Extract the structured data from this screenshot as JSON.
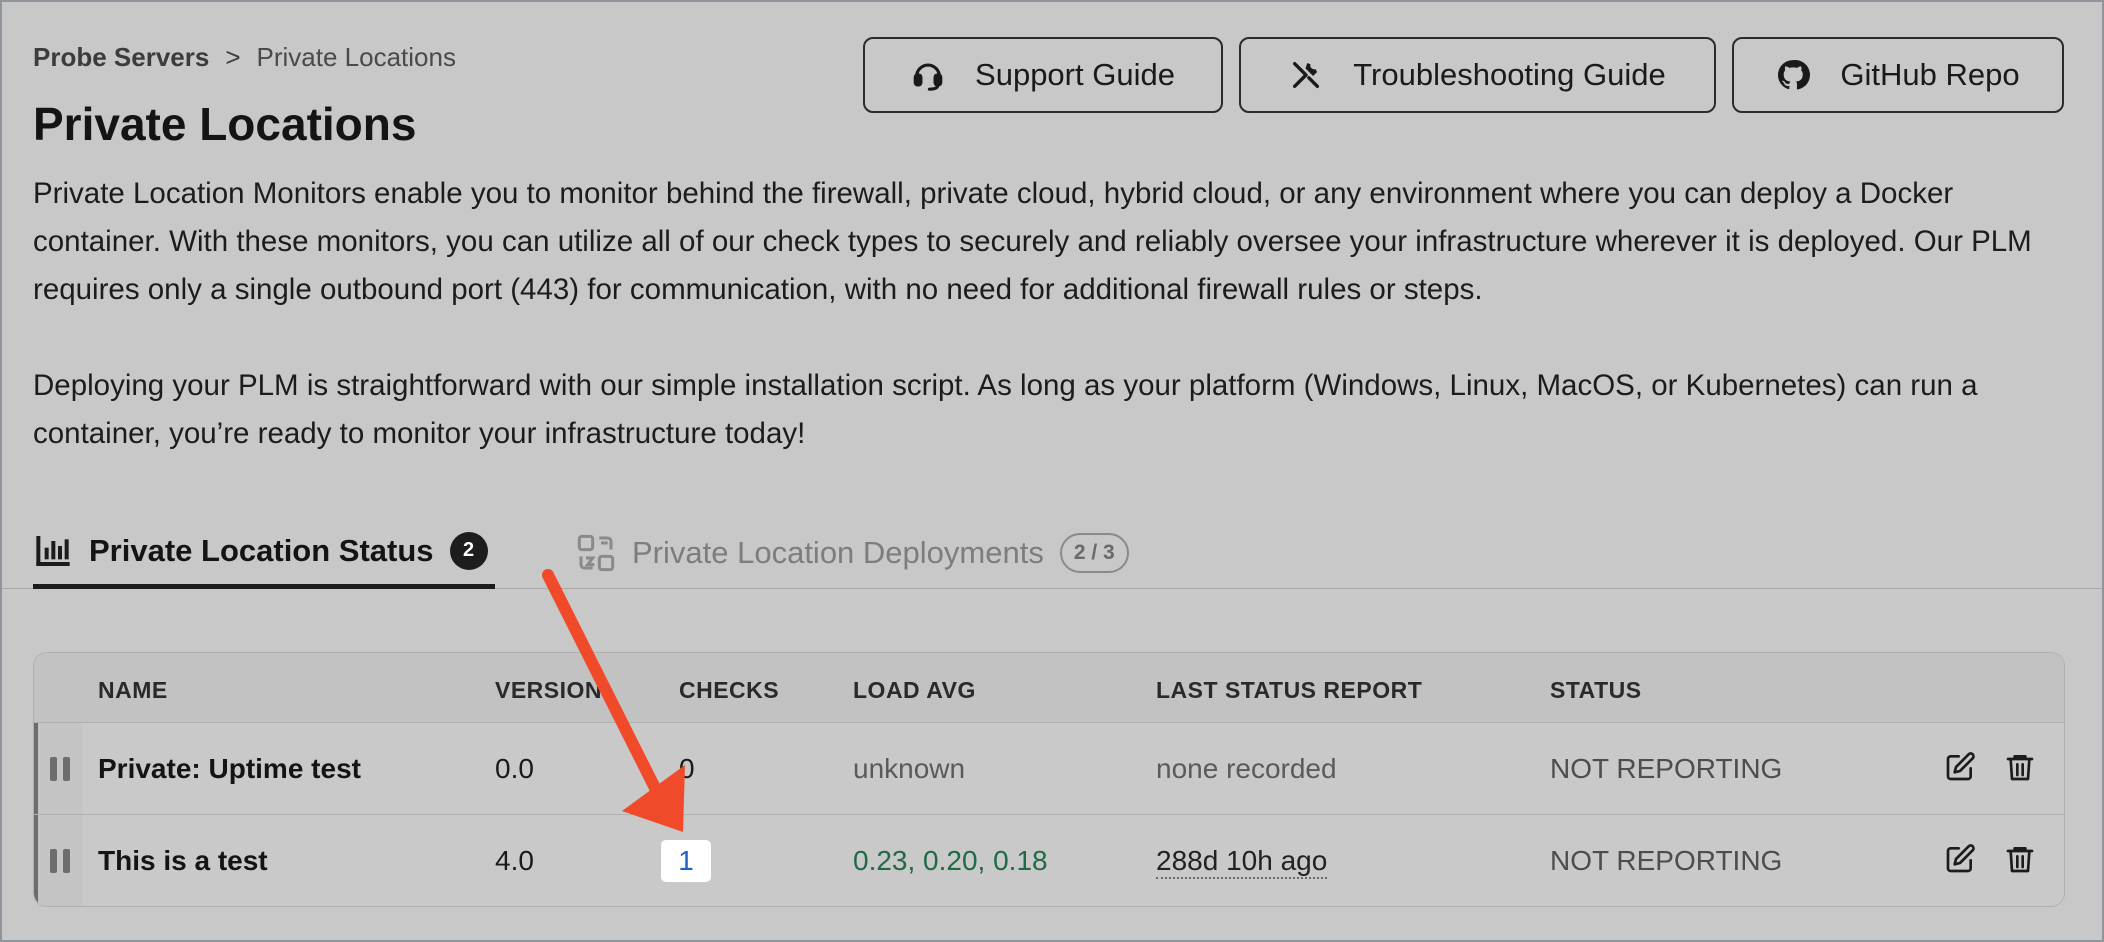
{
  "breadcrumb": {
    "root": "Probe Servers",
    "separator": ">",
    "current": "Private Locations"
  },
  "page_title": "Private Locations",
  "header_buttons": {
    "support": "Support Guide",
    "troubleshooting": "Troubleshooting Guide",
    "github": "GitHub Repo"
  },
  "description": {
    "p1": "Private Location Monitors enable you to monitor behind the firewall, private cloud, hybrid cloud, or any environment where you can deploy a Docker container. With these monitors, you can utilize all of our check types to securely and reliably oversee your infrastructure wherever it is deployed. Our PLM requires only a single outbound port (443) for communication, with no need for additional firewall rules or steps.",
    "p2": "Deploying your PLM is straightforward with our simple installation script. As long as your platform (Windows, Linux, MacOS, or Kubernetes) can run a container, you’re ready to monitor your infrastructure today!"
  },
  "tabs": {
    "status": {
      "label": "Private Location Status",
      "badge": "2"
    },
    "deployments": {
      "label": "Private Location Deployments",
      "badge": "2 / 3"
    }
  },
  "table": {
    "headers": {
      "name": "NAME",
      "version": "VERSION",
      "checks": "CHECKS",
      "load": "LOAD AVG",
      "last": "LAST STATUS REPORT",
      "status": "STATUS"
    },
    "rows": [
      {
        "name": "Private: Uptime test",
        "version": "0.0",
        "checks": "0",
        "load": "unknown",
        "last": "none recorded",
        "status": "NOT REPORTING"
      },
      {
        "name": "This is a test",
        "version": "4.0",
        "checks": "1",
        "load": "0.23, 0.20, 0.18",
        "last": "288d 10h ago",
        "status": "NOT REPORTING"
      }
    ]
  },
  "icons": {
    "support": "headset-icon",
    "troubleshooting": "tools-icon",
    "github": "github-icon",
    "status_tab": "bar-chart-icon",
    "deploy_tab": "deployment-icon",
    "edit": "edit-icon",
    "delete": "trash-icon",
    "drag": "drag-handle-icon"
  },
  "colors": {
    "annotation_arrow": "#f04a2b",
    "checks_link": "#1e64c8",
    "load_ok": "#1f6b45"
  }
}
